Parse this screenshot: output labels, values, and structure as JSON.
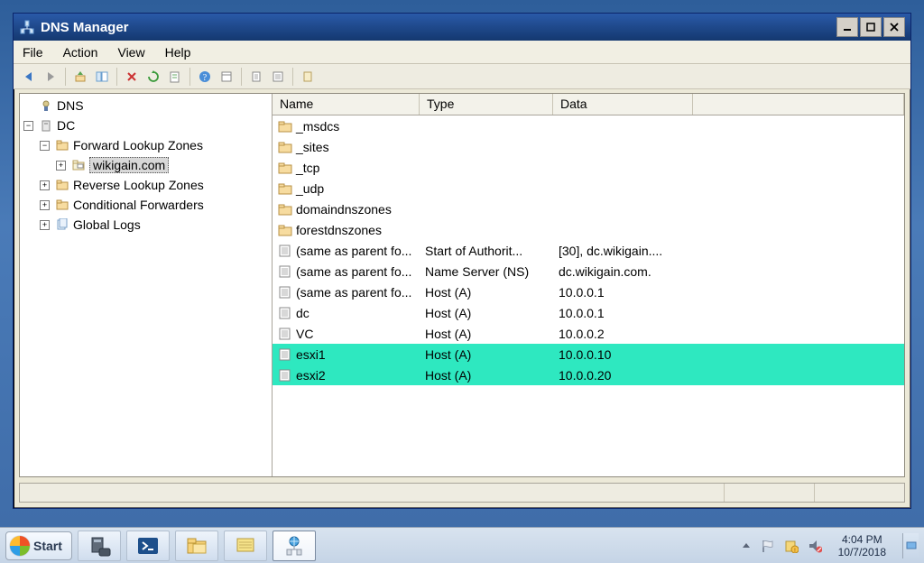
{
  "window": {
    "title": "DNS Manager"
  },
  "menu": {
    "file": "File",
    "action": "Action",
    "view": "View",
    "help": "Help"
  },
  "tree": {
    "root": "DNS",
    "dc": "DC",
    "flz": "Forward Lookup Zones",
    "zone": "wikigain.com",
    "rlz": "Reverse Lookup Zones",
    "cf": "Conditional Forwarders",
    "gl": "Global Logs"
  },
  "columns": {
    "name": "Name",
    "type": "Type",
    "data": "Data"
  },
  "records": [
    {
      "icon": "folder",
      "name": "_msdcs",
      "type": "",
      "data": "",
      "hl": false
    },
    {
      "icon": "folder",
      "name": "_sites",
      "type": "",
      "data": "",
      "hl": false
    },
    {
      "icon": "folder",
      "name": "_tcp",
      "type": "",
      "data": "",
      "hl": false
    },
    {
      "icon": "folder",
      "name": "_udp",
      "type": "",
      "data": "",
      "hl": false
    },
    {
      "icon": "folder",
      "name": "domaindnszones",
      "type": "",
      "data": "",
      "hl": false
    },
    {
      "icon": "folder",
      "name": "forestdnszones",
      "type": "",
      "data": "",
      "hl": false
    },
    {
      "icon": "record",
      "name": "(same as parent fo...",
      "type": "Start of Authorit...",
      "data": "[30], dc.wikigain....",
      "hl": false
    },
    {
      "icon": "record",
      "name": "(same as parent fo...",
      "type": "Name Server (NS)",
      "data": "dc.wikigain.com.",
      "hl": false
    },
    {
      "icon": "record",
      "name": "(same as parent fo...",
      "type": "Host (A)",
      "data": "10.0.0.1",
      "hl": false
    },
    {
      "icon": "record",
      "name": "dc",
      "type": "Host (A)",
      "data": "10.0.0.1",
      "hl": false
    },
    {
      "icon": "record",
      "name": "VC",
      "type": "Host (A)",
      "data": "10.0.0.2",
      "hl": false
    },
    {
      "icon": "record",
      "name": "esxi1",
      "type": "Host (A)",
      "data": "10.0.0.10",
      "hl": true
    },
    {
      "icon": "record",
      "name": "esxi2",
      "type": "Host (A)",
      "data": "10.0.0.20",
      "hl": true
    }
  ],
  "taskbar": {
    "start": "Start",
    "time": "4:04 PM",
    "date": "10/7/2018"
  }
}
